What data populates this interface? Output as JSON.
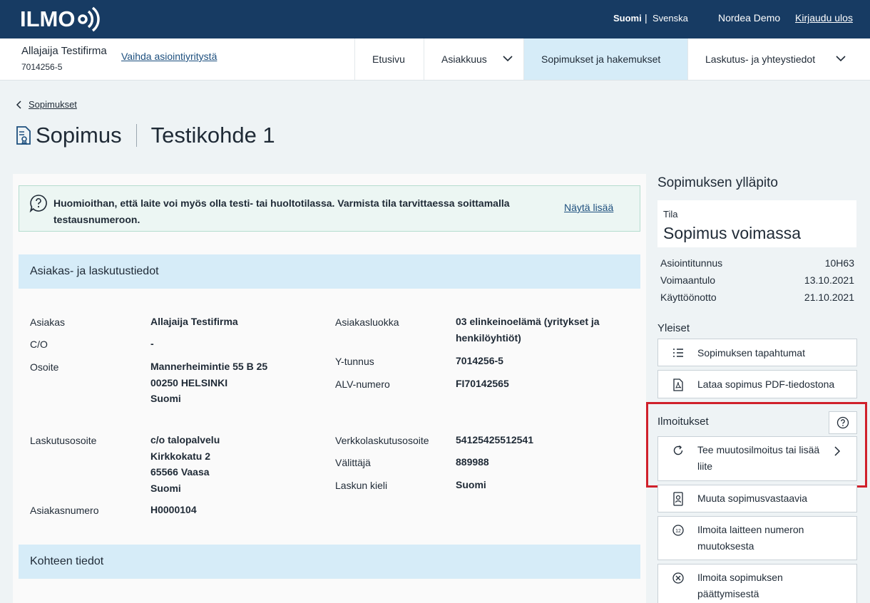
{
  "topbar": {
    "logo_text": "ILMO",
    "lang_active": "Suomi",
    "lang_separator": "|",
    "lang_other": "Svenska",
    "user_name": "Nordea Demo",
    "logout_label": "Kirjaudu ulos"
  },
  "nav": {
    "company_name": "Allajaija Testifirma",
    "company_id": "7014256-5",
    "switch_company": "Vaihda asiointiyritystä",
    "items": [
      {
        "label": "Etusivu"
      },
      {
        "label": "Asiakkuus"
      },
      {
        "label": "Sopimukset ja hakemukset"
      },
      {
        "label": "Laskutus- ja yhteystiedot"
      }
    ]
  },
  "header": {
    "back_label": "Sopimukset",
    "title": "Sopimus",
    "subtitle": "Testikohde 1"
  },
  "notice": {
    "text": "Huomioithan, että laite voi myös olla testi- tai huoltotilassa. Varmista tila tarvittaessa soittamalla testausnumeroon.",
    "link": "Näytä lisää"
  },
  "customer": {
    "section_title": "Asiakas- ja laskutustiedot",
    "left": [
      {
        "label": "Asiakas",
        "value": [
          "Allajaija Testifirma"
        ]
      },
      {
        "label": "C/O",
        "value": [
          "-"
        ]
      },
      {
        "label": "Osoite",
        "value": [
          "Mannerheimintie 55 B 25",
          "00250 HELSINKI",
          "Suomi"
        ]
      },
      {
        "label": "Laskutusosoite",
        "value": [
          "c/o talopalvelu",
          "Kirkkokatu 2",
          "65566 Vaasa",
          "Suomi"
        ]
      },
      {
        "label": "Asiakasnumero",
        "value": [
          "H0000104"
        ]
      }
    ],
    "right": [
      {
        "label": "Asiakasluokka",
        "value": [
          "03 elinkeinoelämä (yritykset ja",
          "henkilöyhtiöt)"
        ]
      },
      {
        "label": "Y-tunnus",
        "value": [
          "7014256-5"
        ]
      },
      {
        "label": "ALV-numero",
        "value": [
          "FI70142565"
        ]
      },
      {
        "label": "Verkkolaskutusosoite",
        "value": [
          "54125425512541"
        ]
      },
      {
        "label": "Välittäjä",
        "value": [
          "889988"
        ]
      },
      {
        "label": "Laskun kieli",
        "value": [
          "Suomi"
        ]
      }
    ]
  },
  "target": {
    "section_title": "Kohteen tiedot"
  },
  "panel": {
    "title": "Sopimuksen ylläpito",
    "status_label": "Tila",
    "status_value": "Sopimus voimassa",
    "meta": [
      {
        "label": "Asiointitunnus",
        "value": "10H63"
      },
      {
        "label": "Voimaantulo",
        "value": "13.10.2021"
      },
      {
        "label": "Käyttöönotto",
        "value": "21.10.2021"
      }
    ],
    "general_title": "Yleiset",
    "general_buttons": [
      {
        "label": "Sopimuksen tapahtumat",
        "icon": "list-icon"
      },
      {
        "label": "Lataa sopimus PDF-tiedostona",
        "icon": "pdf-file-icon"
      }
    ],
    "notices_title": "Ilmoitukset",
    "notice_buttons": [
      {
        "label": "Tee muutosilmoitus tai lisää liite",
        "icon": "refresh-icon"
      },
      {
        "label": "Muuta sopimusvastaavia",
        "icon": "contact-card-icon"
      },
      {
        "label": "Ilmoita laitteen numeron muutoksesta",
        "icon": "number-icon"
      },
      {
        "label": "Ilmoita sopimuksen päättymisestä",
        "icon": "close-circle-icon"
      }
    ],
    "highlight_color": "#d0202b"
  },
  "colors": {
    "topbar": "#173b63",
    "accent_light": "#d6ecf8",
    "notice_bg": "#ecf6f3",
    "link": "#1d4f7e"
  }
}
